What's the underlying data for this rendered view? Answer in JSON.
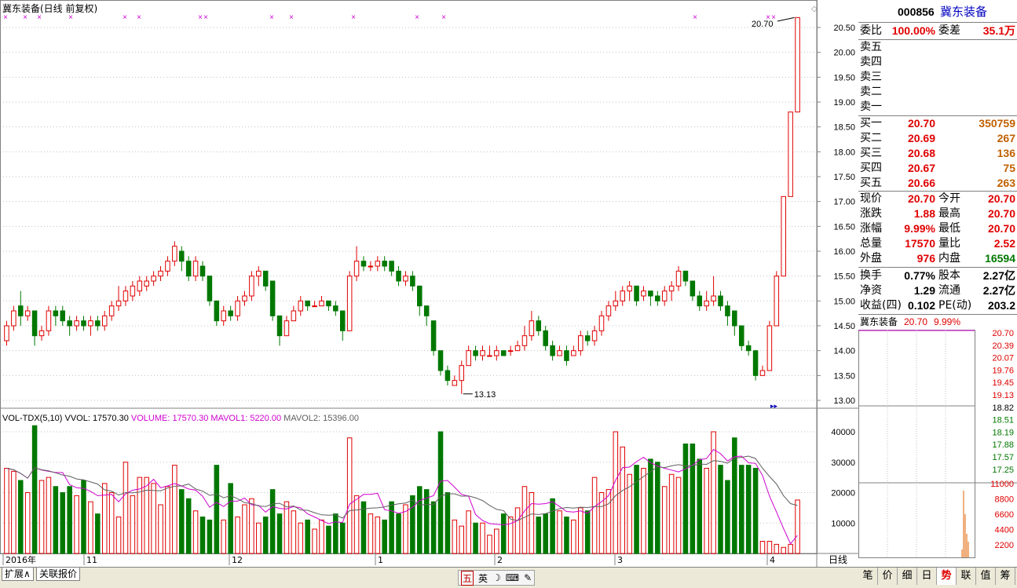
{
  "window": {
    "stock_title": "冀东装备(日线 前复权)",
    "period_label": "日线",
    "max_label": "20.70",
    "min_label": "13.13"
  },
  "price_axis": [
    "20.50",
    "20.00",
    "19.50",
    "19.00",
    "18.50",
    "18.00",
    "17.50",
    "17.00",
    "16.50",
    "16.00",
    "15.50",
    "15.00",
    "14.50",
    "14.00",
    "13.50",
    "13.00"
  ],
  "volume_axis": [
    "40000",
    "30000",
    "20000",
    "10000"
  ],
  "indicator": {
    "name": "VOL-TDX(5,10)",
    "vvol": "VVOL: 17570.30",
    "volume": "VOLUME: 17570.30",
    "mavol1": "MAVOL1: 5220.00",
    "mavol2": "MAVOL2: 15396.00"
  },
  "x_axis": [
    "2016年",
    "11",
    "12",
    "1",
    "2",
    "3",
    "4"
  ],
  "colors": {
    "up": "#e00000",
    "down": "#007800",
    "grid": "#c0c0c0",
    "ma1": "#d000d0",
    "ma2": "#606060",
    "accent_blue": "#0000c0"
  },
  "chart_data": {
    "type": "candlestick",
    "price_ylim": [
      13.0,
      20.5
    ],
    "volume_ylim": [
      0,
      40000
    ],
    "candles": [
      [
        14.2,
        14.5,
        14.6,
        14.1,
        28000
      ],
      [
        14.5,
        14.8,
        14.9,
        14.4,
        27000
      ],
      [
        14.9,
        14.7,
        15.2,
        14.5,
        24000
      ],
      [
        14.7,
        14.8,
        14.9,
        14.6,
        20000
      ],
      [
        14.8,
        14.3,
        14.8,
        14.1,
        42000
      ],
      [
        14.3,
        14.4,
        14.5,
        14.2,
        24000
      ],
      [
        14.4,
        14.8,
        14.9,
        14.3,
        25000
      ],
      [
        14.8,
        14.7,
        14.9,
        14.5,
        22000
      ],
      [
        14.8,
        14.6,
        14.9,
        14.5,
        20000
      ],
      [
        14.6,
        14.5,
        14.7,
        14.3,
        22000
      ],
      [
        14.5,
        14.6,
        14.7,
        14.4,
        19000
      ],
      [
        14.6,
        14.5,
        14.7,
        14.4,
        24000
      ],
      [
        14.5,
        14.6,
        14.7,
        14.3,
        17000
      ],
      [
        14.6,
        14.5,
        14.7,
        14.4,
        13000
      ],
      [
        14.5,
        14.7,
        14.8,
        14.4,
        23000
      ],
      [
        14.7,
        14.9,
        15.0,
        14.6,
        20000
      ],
      [
        14.9,
        15.0,
        15.3,
        14.8,
        12000
      ],
      [
        15.0,
        15.2,
        15.3,
        14.9,
        30000
      ],
      [
        15.1,
        15.3,
        15.4,
        15.0,
        19000
      ],
      [
        15.2,
        15.4,
        15.5,
        15.1,
        25000
      ],
      [
        15.3,
        15.4,
        15.5,
        15.2,
        25000
      ],
      [
        15.4,
        15.5,
        15.6,
        15.3,
        23000
      ],
      [
        15.5,
        15.6,
        15.7,
        15.4,
        16000
      ],
      [
        15.6,
        15.8,
        15.9,
        15.5,
        22000
      ],
      [
        15.8,
        16.1,
        16.2,
        15.7,
        29000
      ],
      [
        16.0,
        15.8,
        16.1,
        15.6,
        21000
      ],
      [
        15.8,
        15.5,
        15.9,
        15.4,
        18000
      ],
      [
        15.5,
        15.8,
        15.9,
        15.4,
        14000
      ],
      [
        15.7,
        15.5,
        15.8,
        15.4,
        12000
      ],
      [
        15.5,
        15.0,
        15.5,
        14.9,
        11000
      ],
      [
        15.0,
        14.6,
        15.0,
        14.5,
        29000
      ],
      [
        14.6,
        14.8,
        14.9,
        14.5,
        11000
      ],
      [
        14.8,
        14.7,
        14.9,
        14.6,
        23000
      ],
      [
        14.7,
        15.0,
        15.1,
        14.6,
        12000
      ],
      [
        15.0,
        15.1,
        15.2,
        14.9,
        16000
      ],
      [
        15.1,
        15.5,
        15.6,
        15.0,
        18000
      ],
      [
        15.5,
        15.6,
        15.7,
        15.3,
        10000
      ],
      [
        15.6,
        15.3,
        15.6,
        15.2,
        12000
      ],
      [
        15.4,
        14.7,
        15.4,
        14.6,
        21000
      ],
      [
        14.7,
        14.3,
        14.7,
        14.1,
        13000
      ],
      [
        14.3,
        14.6,
        14.7,
        14.3,
        17000
      ],
      [
        14.6,
        14.8,
        14.9,
        14.6,
        14000
      ],
      [
        14.8,
        15.0,
        15.1,
        14.7,
        10000
      ],
      [
        15.0,
        14.9,
        15.0,
        14.8,
        11000
      ],
      [
        14.9,
        14.9,
        15.0,
        14.9,
        8000
      ],
      [
        14.9,
        15.0,
        15.1,
        14.9,
        11000
      ],
      [
        15.0,
        14.9,
        15.0,
        14.8,
        9000
      ],
      [
        14.9,
        14.8,
        15.0,
        14.7,
        13000
      ],
      [
        14.8,
        14.4,
        14.8,
        14.2,
        10000
      ],
      [
        14.4,
        15.5,
        15.6,
        14.4,
        38000
      ],
      [
        15.5,
        15.8,
        16.1,
        15.4,
        19000
      ],
      [
        15.8,
        15.7,
        15.9,
        15.6,
        17000
      ],
      [
        15.7,
        15.7,
        15.8,
        15.6,
        13000
      ],
      [
        15.7,
        15.8,
        15.9,
        15.6,
        12000
      ],
      [
        15.8,
        15.7,
        15.9,
        15.6,
        11000
      ],
      [
        15.8,
        15.6,
        15.8,
        15.5,
        17000
      ],
      [
        15.6,
        15.4,
        15.7,
        15.3,
        13000
      ],
      [
        15.4,
        15.5,
        15.6,
        15.3,
        16000
      ],
      [
        15.5,
        15.3,
        15.6,
        15.2,
        19000
      ],
      [
        15.3,
        14.9,
        15.3,
        14.7,
        22000
      ],
      [
        14.9,
        14.7,
        14.9,
        14.5,
        21000
      ],
      [
        14.6,
        14.0,
        14.6,
        13.9,
        17000
      ],
      [
        14.0,
        13.6,
        14.0,
        13.5,
        40000
      ],
      [
        13.6,
        13.4,
        13.7,
        13.3,
        20000
      ],
      [
        13.3,
        13.4,
        13.5,
        13.3,
        11000
      ],
      [
        13.4,
        13.7,
        13.8,
        13.13,
        9000
      ],
      [
        13.7,
        14.0,
        14.1,
        13.7,
        14000
      ],
      [
        14.0,
        13.9,
        14.1,
        13.8,
        10000
      ],
      [
        13.9,
        14.0,
        14.1,
        13.8,
        10000
      ],
      [
        13.9,
        13.9,
        14.1,
        13.9,
        6000
      ],
      [
        13.9,
        14.0,
        14.1,
        13.8,
        8000
      ],
      [
        14.0,
        13.9,
        14.0,
        13.9,
        13000
      ],
      [
        14.0,
        14.0,
        14.1,
        13.9,
        12000
      ],
      [
        14.0,
        14.1,
        14.2,
        14.0,
        15000
      ],
      [
        14.1,
        14.3,
        14.5,
        14.0,
        22000
      ],
      [
        14.3,
        14.6,
        14.8,
        14.2,
        20000
      ],
      [
        14.6,
        14.4,
        14.7,
        14.3,
        12000
      ],
      [
        14.4,
        14.1,
        14.5,
        14.0,
        13000
      ],
      [
        14.1,
        13.9,
        14.2,
        13.8,
        18000
      ],
      [
        13.9,
        14.0,
        14.1,
        13.9,
        14000
      ],
      [
        14.0,
        13.8,
        14.1,
        13.7,
        12000
      ],
      [
        13.9,
        14.0,
        14.1,
        13.9,
        11000
      ],
      [
        14.0,
        14.3,
        14.4,
        13.9,
        15000
      ],
      [
        14.3,
        14.2,
        14.4,
        14.1,
        14000
      ],
      [
        14.2,
        14.4,
        14.5,
        14.1,
        25000
      ],
      [
        14.4,
        14.7,
        14.8,
        14.3,
        20000
      ],
      [
        14.7,
        14.9,
        15.0,
        14.6,
        21000
      ],
      [
        14.9,
        15.0,
        15.2,
        14.8,
        40000
      ],
      [
        15.0,
        15.2,
        15.3,
        14.9,
        35000
      ],
      [
        15.2,
        15.3,
        15.4,
        15.0,
        26000
      ],
      [
        15.3,
        15.0,
        15.3,
        14.9,
        29000
      ],
      [
        15.1,
        15.2,
        15.3,
        15.0,
        28000
      ],
      [
        15.2,
        15.1,
        15.2,
        14.9,
        31000
      ],
      [
        15.1,
        15.0,
        15.2,
        14.9,
        30000
      ],
      [
        15.0,
        15.2,
        15.3,
        14.9,
        22000
      ],
      [
        15.2,
        15.3,
        15.4,
        15.0,
        26000
      ],
      [
        15.3,
        15.6,
        15.7,
        15.2,
        25000
      ],
      [
        15.6,
        15.4,
        15.6,
        15.3,
        36000
      ],
      [
        15.4,
        15.1,
        15.4,
        15.0,
        36000
      ],
      [
        15.1,
        14.9,
        15.2,
        14.8,
        31000
      ],
      [
        14.9,
        15.0,
        15.2,
        14.8,
        28000
      ],
      [
        15.0,
        15.1,
        15.5,
        14.9,
        40000
      ],
      [
        15.1,
        14.9,
        15.2,
        14.8,
        29000
      ],
      [
        14.9,
        14.7,
        15.0,
        14.5,
        24000
      ],
      [
        14.8,
        14.5,
        14.8,
        14.3,
        38000
      ],
      [
        14.5,
        14.1,
        14.5,
        14.0,
        29000
      ],
      [
        14.1,
        14.0,
        14.2,
        13.9,
        29000
      ],
      [
        14.0,
        13.5,
        14.0,
        13.4,
        28000
      ],
      [
        13.5,
        13.6,
        13.7,
        13.5,
        4000
      ],
      [
        13.6,
        14.5,
        14.6,
        13.6,
        4000
      ],
      [
        14.5,
        15.5,
        15.6,
        14.5,
        3000
      ],
      [
        15.5,
        17.1,
        17.1,
        15.5,
        2000
      ],
      [
        17.1,
        18.8,
        18.8,
        17.1,
        3000
      ],
      [
        18.8,
        20.7,
        20.7,
        18.8,
        17570
      ]
    ]
  },
  "quote": {
    "code": "000856",
    "name": "冀东装备",
    "weibi_label": "委比",
    "weibi_value": "100.00%",
    "weicha_label": "委差",
    "weicha_value": "35.1万",
    "sell": [
      {
        "label": "卖五",
        "price": "",
        "vol": ""
      },
      {
        "label": "卖四",
        "price": "",
        "vol": ""
      },
      {
        "label": "卖三",
        "price": "",
        "vol": ""
      },
      {
        "label": "卖二",
        "price": "",
        "vol": ""
      },
      {
        "label": "卖一",
        "price": "",
        "vol": ""
      }
    ],
    "buy": [
      {
        "label": "买一",
        "price": "20.70",
        "vol": "350759"
      },
      {
        "label": "买二",
        "price": "20.69",
        "vol": "267"
      },
      {
        "label": "买三",
        "price": "20.68",
        "vol": "136"
      },
      {
        "label": "买四",
        "price": "20.67",
        "vol": "75"
      },
      {
        "label": "买五",
        "price": "20.66",
        "vol": "263"
      }
    ],
    "stats": [
      {
        "l1": "现价",
        "v1": "20.70",
        "l2": "今开",
        "v2": "20.70",
        "c1": "#e00000",
        "c2": "#e00000"
      },
      {
        "l1": "涨跌",
        "v1": "1.88",
        "l2": "最高",
        "v2": "20.70",
        "c1": "#e00000",
        "c2": "#e00000"
      },
      {
        "l1": "涨幅",
        "v1": "9.99%",
        "l2": "最低",
        "v2": "20.70",
        "c1": "#e00000",
        "c2": "#e00000"
      },
      {
        "l1": "总量",
        "v1": "17570",
        "l2": "量比",
        "v2": "2.52",
        "c1": "#e00000",
        "c2": "#e00000"
      },
      {
        "l1": "外盘",
        "v1": "976",
        "l2": "内盘",
        "v2": "16594",
        "c1": "#e00000",
        "c2": "#007800"
      }
    ],
    "fund": [
      {
        "l1": "换手",
        "v1": "0.77%",
        "l2": "股本",
        "v2": "2.27亿"
      },
      {
        "l1": "净资",
        "v1": "1.29",
        "l2": "流通",
        "v2": "2.27亿"
      },
      {
        "l1": "收益(四)",
        "v1": "0.102",
        "l2": "PE(动)",
        "v2": "203.2"
      }
    ],
    "mini_title": "冀东装备",
    "mini_price": "20.70",
    "mini_pct": "9.99%",
    "mini_price_axis": [
      "20.70",
      "20.39",
      "20.07",
      "19.76",
      "19.45",
      "19.13",
      "18.82",
      "18.51",
      "18.19",
      "17.88",
      "17.57",
      "17.25"
    ],
    "mini_vol_axis": [
      "11000",
      "8800",
      "6600",
      "4400",
      "2200"
    ]
  },
  "bottom": {
    "tab_expand": "扩展∧",
    "tab_related": "关联报价",
    "right_tabs": [
      "笔",
      "价",
      "细",
      "日",
      "势",
      "联",
      "值",
      "筹"
    ],
    "ime_items": [
      "五",
      "英",
      "☽",
      "⌨",
      "✎"
    ]
  }
}
